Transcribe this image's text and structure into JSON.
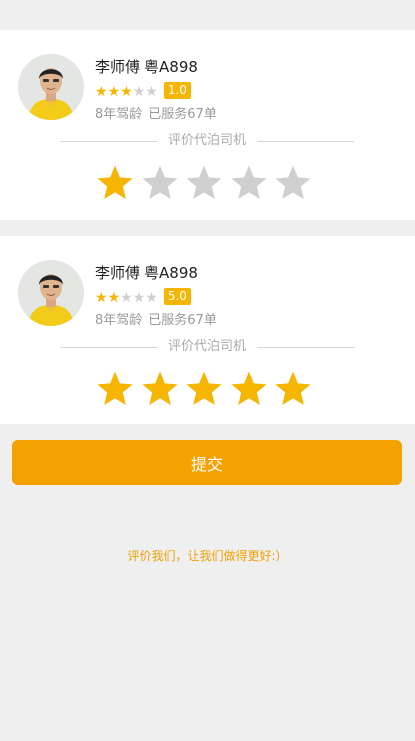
{
  "cards": [
    {
      "driver_name": "李师傅",
      "plate": "粤A898",
      "star_rating": 3,
      "score": "1.0",
      "experience": "8年驾龄",
      "orders": "已服务67单",
      "section_label": "评价代泊司机",
      "user_rating": 1
    },
    {
      "driver_name": "李师傅",
      "plate": "粤A898",
      "star_rating": 2,
      "score": "5.0",
      "experience": "8年驾龄",
      "orders": "已服务67单",
      "section_label": "评价代泊司机",
      "user_rating": 5
    }
  ],
  "submit_label": "提交",
  "footer_text": "评价我们，让我们做得更好:）",
  "colors": {
    "star_active": "#f5b500",
    "star_inactive": "#cfcfcf",
    "button": "#f5a100",
    "footer": "#f0a000"
  },
  "icons": {
    "avatar": "driver-avatar-photo",
    "star": "star-icon"
  }
}
